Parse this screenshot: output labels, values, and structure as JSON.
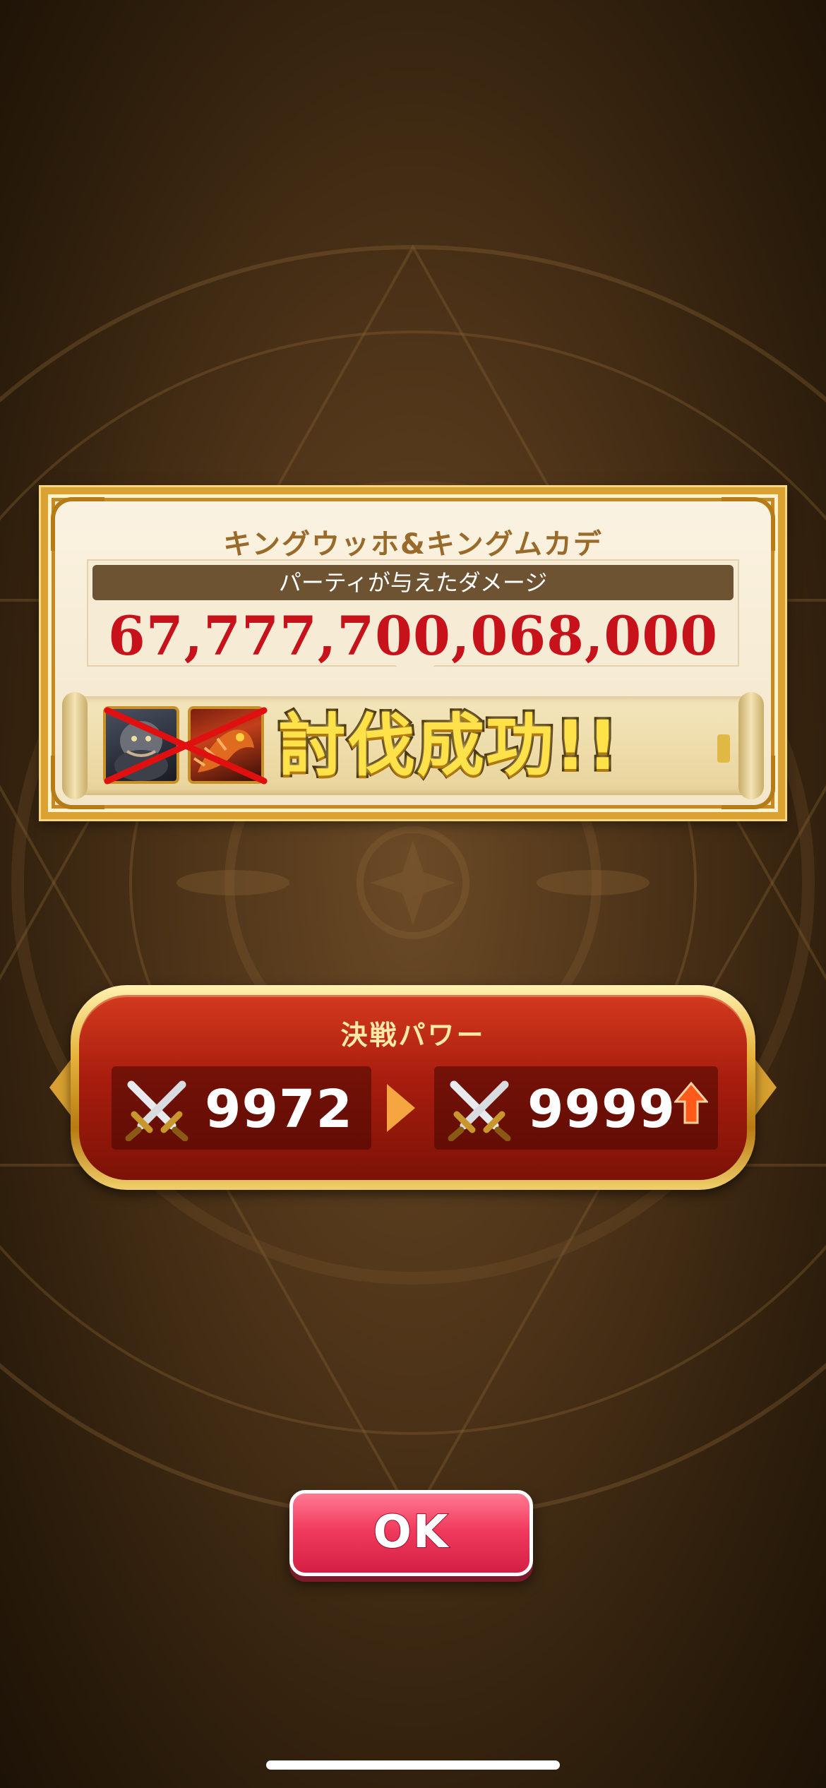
{
  "result": {
    "enemy_name": "キングウッホ&キングムカデ",
    "damage_label": "パーティが与えたダメージ",
    "damage_value": "67,777,700,068,000",
    "success_text": "討伐成功!!"
  },
  "power": {
    "title": "決戦パワー",
    "before": "9972",
    "after": "9999",
    "trend": "up"
  },
  "ok_button": {
    "label": "OK"
  },
  "icons": {
    "swords": "crossed-swords-icon",
    "arrow": "arrow-right-icon",
    "trend": "up-arrow-icon",
    "defeated": "defeated-x-mark"
  },
  "colors": {
    "damage": "#c8121b",
    "ok_button": "#f23c5e",
    "power_panel": "#a81d0e",
    "frame_gold": "#d9a233"
  }
}
